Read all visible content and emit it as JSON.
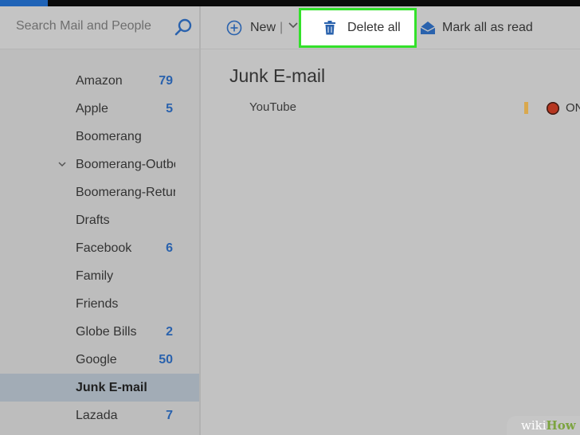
{
  "search": {
    "placeholder": "Search Mail and People"
  },
  "toolbar": {
    "new_label": "New",
    "new_separator": "|",
    "delete_all_label": "Delete all",
    "mark_all_read_label": "Mark all as read"
  },
  "folders": [
    {
      "label": "Amazon",
      "count": "79"
    },
    {
      "label": "Apple",
      "count": "5"
    },
    {
      "label": "Boomerang",
      "count": ""
    },
    {
      "label": "Boomerang-Outbox",
      "count": "",
      "expandable": true
    },
    {
      "label": "Boomerang-Returned",
      "count": ""
    },
    {
      "label": "Drafts",
      "count": ""
    },
    {
      "label": "Facebook",
      "count": "6"
    },
    {
      "label": "Family",
      "count": ""
    },
    {
      "label": "Friends",
      "count": ""
    },
    {
      "label": "Globe Bills",
      "count": "2"
    },
    {
      "label": "Google",
      "count": "50"
    },
    {
      "label": "Junk E-mail",
      "count": "",
      "active": true
    },
    {
      "label": "Lazada",
      "count": "7"
    }
  ],
  "main": {
    "title": "Junk E-mail",
    "messages": [
      {
        "sender": "YouTube",
        "category": "ON"
      }
    ]
  },
  "watermark": {
    "part1": "wiki",
    "part2": "How"
  },
  "colors": {
    "highlight_border": "#33e12a",
    "count_text": "#2a62ad",
    "flag": "#d9a84d",
    "category_dot": "#b63620",
    "accent": "#1f63b7"
  },
  "icons": {
    "search": "search-icon",
    "new": "plus-circle-icon",
    "new_dropdown": "chevron-down-icon",
    "delete": "trash-icon",
    "mark_read": "envelope-open-icon",
    "folder_expand": "chevron-down-icon"
  }
}
